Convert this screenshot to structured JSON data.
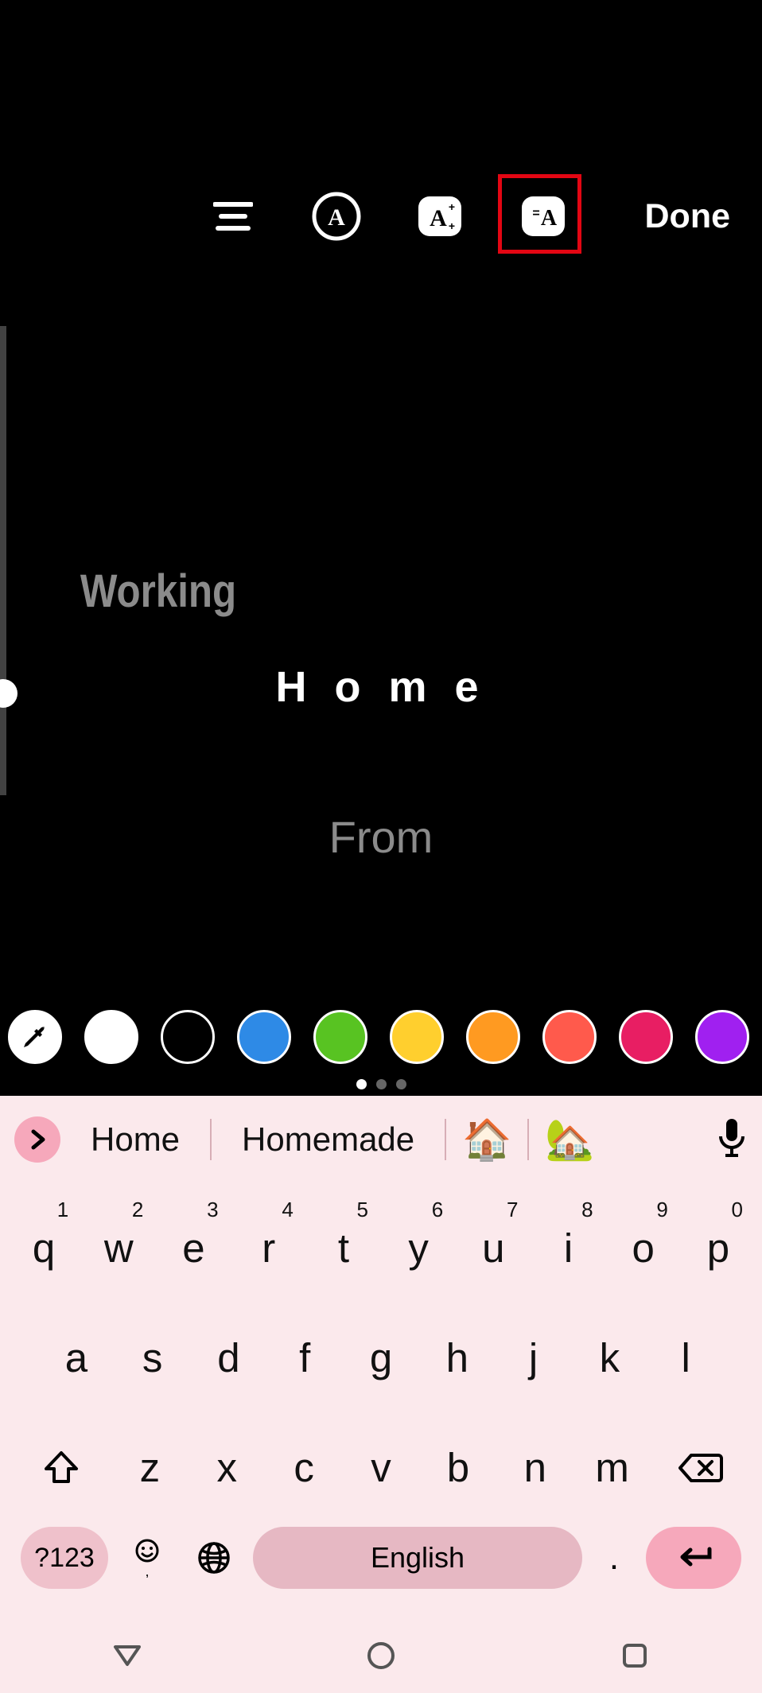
{
  "toolbar": {
    "done_label": "Done"
  },
  "texts": {
    "working": "Working",
    "home": "H o m e",
    "from": "From"
  },
  "palette": {
    "colors": [
      "#ffffff",
      "#000000",
      "#2e8ae6",
      "#58c322",
      "#ffcf2e",
      "#ff9a21",
      "#ff5a4c",
      "#e81e63",
      "#a020f0"
    ],
    "active_page": 0,
    "page_count": 3
  },
  "keyboard": {
    "suggestions": {
      "s1": "Home",
      "s2": "Homemade",
      "e1": "🏠",
      "e2": "🏡"
    },
    "rows": {
      "r1": [
        {
          "k": "q",
          "n": "1"
        },
        {
          "k": "w",
          "n": "2"
        },
        {
          "k": "e",
          "n": "3"
        },
        {
          "k": "r",
          "n": "4"
        },
        {
          "k": "t",
          "n": "5"
        },
        {
          "k": "y",
          "n": "6"
        },
        {
          "k": "u",
          "n": "7"
        },
        {
          "k": "i",
          "n": "8"
        },
        {
          "k": "o",
          "n": "9"
        },
        {
          "k": "p",
          "n": "0"
        }
      ],
      "r2": [
        "a",
        "s",
        "d",
        "f",
        "g",
        "h",
        "j",
        "k",
        "l"
      ],
      "r3": [
        "z",
        "x",
        "c",
        "v",
        "b",
        "n",
        "m"
      ]
    },
    "symbols_label": "?123",
    "space_label": "English",
    "period": "."
  }
}
